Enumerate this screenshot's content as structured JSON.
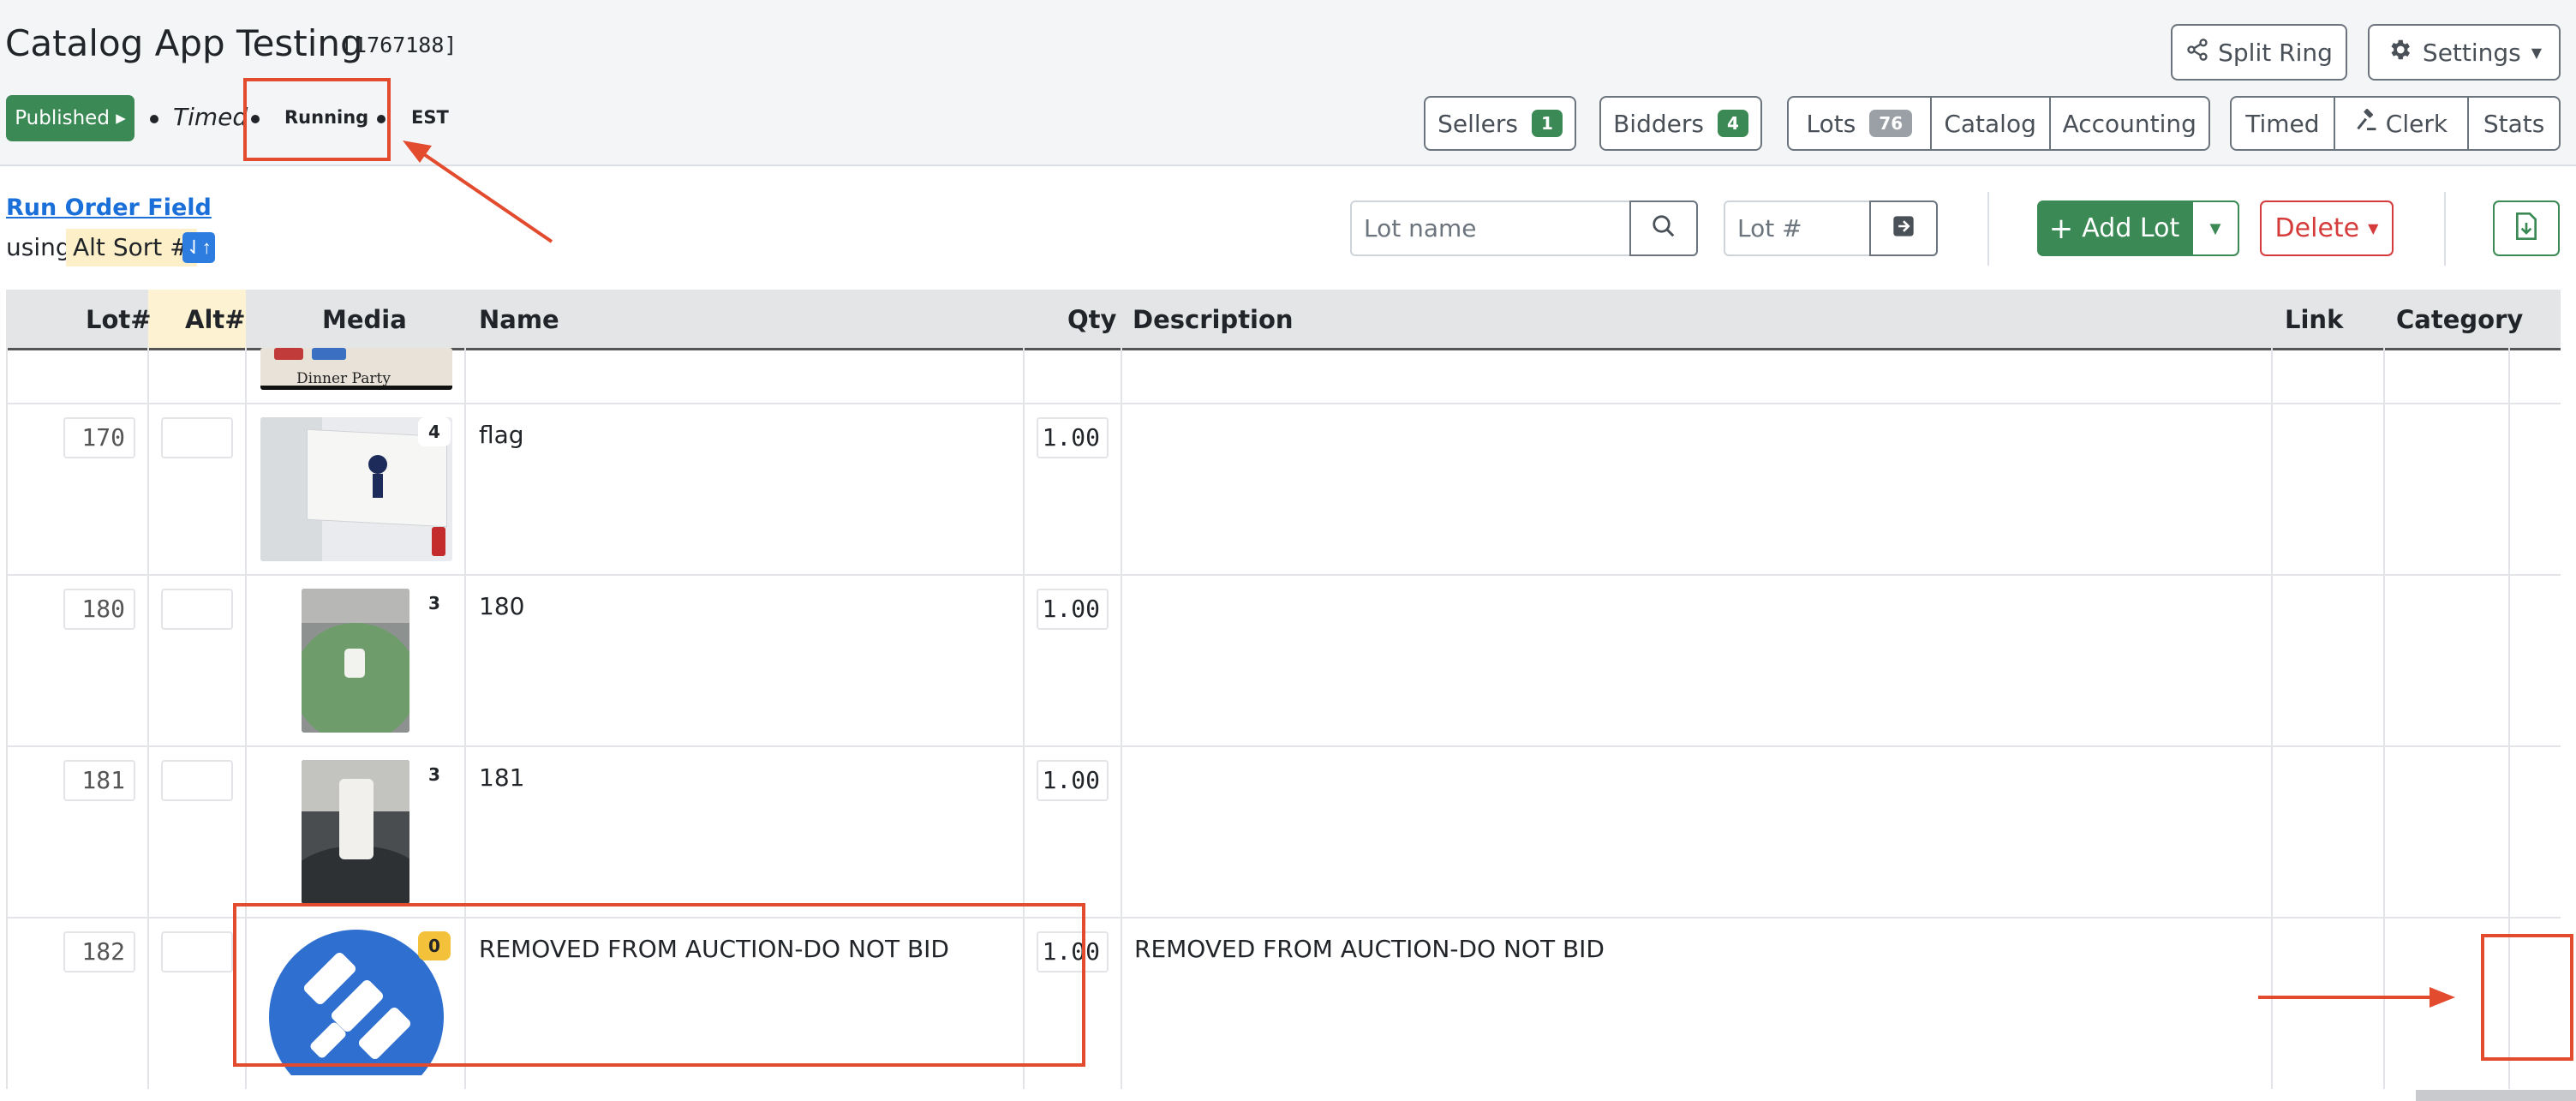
{
  "app": {
    "title": "Catalog App Testing",
    "id": "[1767188]"
  },
  "status": {
    "published": "Published ▸",
    "mode": "Timed",
    "state": "Running",
    "timezone": "EST"
  },
  "header_buttons": {
    "split_ring": "Split Ring",
    "settings": "Settings"
  },
  "nav": {
    "sellers": {
      "label": "Sellers",
      "count": "1"
    },
    "bidders": {
      "label": "Bidders",
      "count": "4"
    },
    "lots": {
      "label": "Lots",
      "count": "76"
    },
    "catalog": "Catalog",
    "accounting": "Accounting",
    "timed": "Timed",
    "clerk": "Clerk",
    "stats": "Stats"
  },
  "toolbar": {
    "run_order_link": "Run Order Field",
    "using_label": "using",
    "sort_field": "Alt Sort #",
    "lot_name_placeholder": "Lot name",
    "lot_num_placeholder": "Lot #",
    "add_lot": "Add Lot",
    "delete": "Delete"
  },
  "table": {
    "columns": [
      "Lot#",
      "Alt#",
      "Media",
      "Name",
      "Qty",
      "Description",
      "Link",
      "Category"
    ],
    "partial_top_image_caption": "Dinner Party",
    "rows": [
      {
        "lot": "170",
        "alt": "",
        "media_count": "4",
        "name": "flag",
        "qty": "1.00",
        "description": ""
      },
      {
        "lot": "180",
        "alt": "",
        "media_count": "3",
        "name": "180",
        "qty": "1.00",
        "description": ""
      },
      {
        "lot": "181",
        "alt": "",
        "media_count": "3",
        "name": "181",
        "qty": "1.00",
        "description": ""
      },
      {
        "lot": "182",
        "alt": "",
        "media_count": "0",
        "name": "REMOVED FROM AUCTION-DO NOT BID",
        "qty": "1.00",
        "description": "REMOVED FROM AUCTION-DO NOT BID"
      }
    ]
  },
  "colors": {
    "accent_green": "#3b8a55",
    "danger": "#d63b3b",
    "link_blue": "#1a6fd9",
    "annotation_red": "#e34b2f"
  }
}
